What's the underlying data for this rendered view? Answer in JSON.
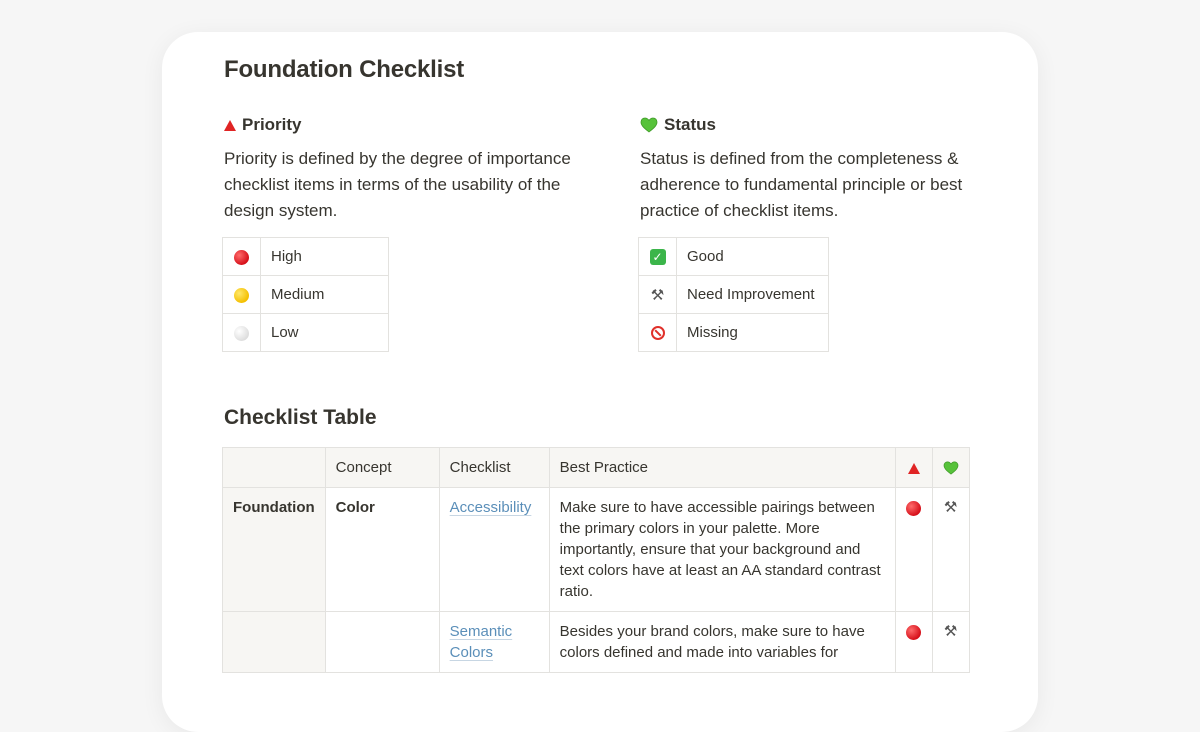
{
  "page": {
    "title": "Foundation Checklist"
  },
  "priority": {
    "heading": "Priority",
    "icon": "red-triangle-icon",
    "description": "Priority is defined by the degree of importance checklist items in terms of the usability of the design system.",
    "levels": [
      {
        "icon": "red-circle-icon",
        "label": "High"
      },
      {
        "icon": "yellow-circle-icon",
        "label": "Medium"
      },
      {
        "icon": "white-circle-icon",
        "label": "Low"
      }
    ]
  },
  "status": {
    "heading": "Status",
    "icon": "green-heart-icon",
    "description": "Status is defined from the completeness & adherence to fundamental principle or best practice of checklist items.",
    "levels": [
      {
        "icon": "check-mark-icon",
        "label": "Good"
      },
      {
        "icon": "tools-icon",
        "label": "Need Improvement"
      },
      {
        "icon": "no-entry-icon",
        "label": "Missing"
      }
    ]
  },
  "checklist_table": {
    "title": "Checklist Table",
    "headers": {
      "col1": "",
      "concept": "Concept",
      "checklist": "Checklist",
      "best_practice": "Best Practice"
    },
    "rows": [
      {
        "category": "Foundation",
        "concept": "Color",
        "checklist": "Accessibility",
        "best_practice": "Make sure to have accessible pairings between the primary colors in your palette. More importantly, ensure that your background and text colors have at least an AA standard contrast ratio.",
        "priority": "red-circle-icon",
        "status": "tools-icon"
      },
      {
        "category": "",
        "concept": "",
        "checklist": "Semantic Colors",
        "best_practice": "Besides your brand colors, make sure to have colors defined and made into variables for",
        "priority": "red-circle-icon",
        "status": "tools-icon"
      }
    ]
  },
  "colors": {
    "accent_red": "#e02424",
    "link": "#5b8fb9",
    "good_green": "#3bb54a"
  }
}
